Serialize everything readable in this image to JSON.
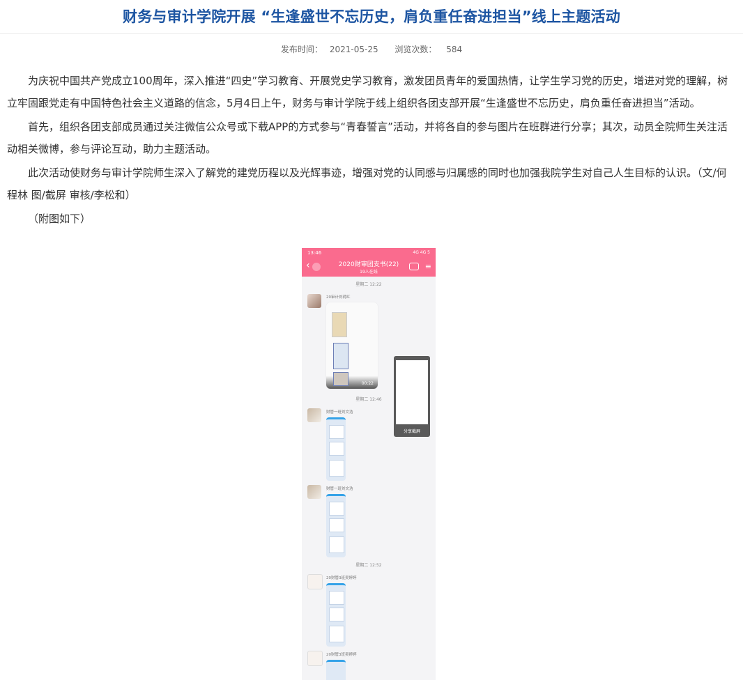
{
  "article": {
    "title": "财务与审计学院开展 “生逢盛世不忘历史，肩负重任奋进担当”线上主题活动",
    "meta": {
      "publish_label": "发布时间：",
      "publish_date": "2021-05-25",
      "views_label": "浏览次数：",
      "views": "584"
    },
    "paragraphs": [
      "为庆祝中国共产党成立100周年，深入推进“四史”学习教育、开展党史学习教育，激发团员青年的爱国热情，让学生学习党的历史，增进对党的理解，树立牢固跟党走有中国特色社会主义道路的信念，5月4日上午，财务与审计学院于线上组织各团支部开展“生逢盛世不忘历史，肩负重任奋进担当”活动。",
      "首先，组织各团支部成员通过关注微信公众号或下载APP的方式参与“青春誓言”活动，并将各自的参与图片在班群进行分享；其次，动员全院师生关注活动相关微博，参与评论互动，助力主题活动。",
      "此次活动使财务与审计学院师生深入了解党的建党历程以及光辉事迹，增强对党的认同感与归属感的同时也加强我院学生对自己人生目标的认识。（文/何程林 图/截屏 审核/李松和）"
    ],
    "caption": "（附图如下）"
  },
  "phone": {
    "status_time": "13:46",
    "status_right": "4G 4G 5",
    "chat_title": "2020财审团支书(22)",
    "chat_subtitle": "19人在线",
    "timestamps": [
      "星期二 12:22",
      "星期二 12:46",
      "星期二 12:52"
    ],
    "senders": [
      "20审计刘荷红",
      "财管一班刘文浩",
      "财管一班刘文浩",
      "20财管3班吴婷婷",
      "20财管3班吴婷婷"
    ],
    "video_duration": "00:22",
    "floating_label": "分享截屏"
  },
  "colors": {
    "title": "#1d55a2",
    "phone_header": "#fa6b8e",
    "bubble_accent": "#36a3e8"
  }
}
